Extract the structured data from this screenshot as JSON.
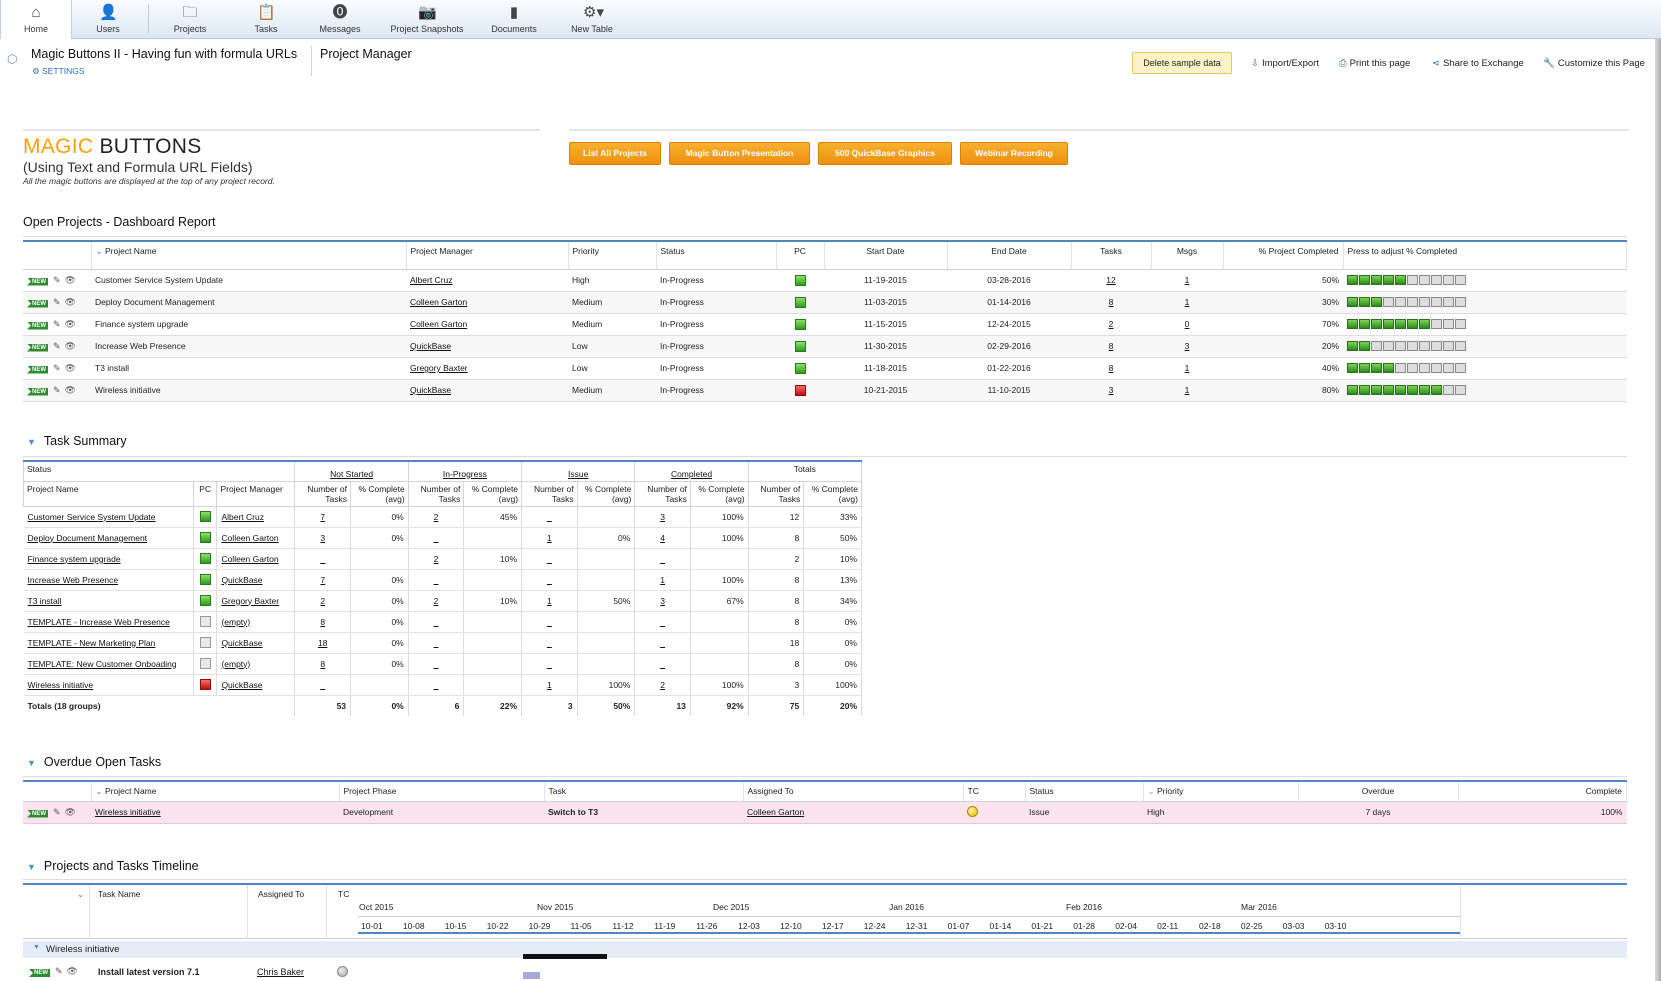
{
  "nav": [
    {
      "label": "Home",
      "icon": "home-icon",
      "glyph": "⌂",
      "active": true
    },
    {
      "label": "Users",
      "icon": "user-icon",
      "glyph": "👤"
    },
    {
      "label": "Projects",
      "icon": "folder-icon",
      "glyph": "🗀"
    },
    {
      "label": "Tasks",
      "icon": "clipboard-icon",
      "glyph": "📋"
    },
    {
      "label": "Messages",
      "icon": "speech-bubble-icon",
      "glyph": "⓿"
    },
    {
      "label": "Project Snapshots",
      "icon": "camera-icon",
      "glyph": "📷"
    },
    {
      "label": "Documents",
      "icon": "document-icon",
      "glyph": "▮"
    },
    {
      "label": "New Table",
      "icon": "gear-plus-icon",
      "glyph": "⚙▾"
    }
  ],
  "app": {
    "title": "Magic Buttons II - Having fun with formula URLs",
    "settings": "SETTINGS",
    "page": "Project Manager"
  },
  "toolbar": {
    "delete": "Delete sample data",
    "import": "Import/Export",
    "print": "Print this page",
    "share": "Share to Exchange",
    "customize": "Customize this Page"
  },
  "hero": {
    "title_accent": "MAGIC",
    "title_rest": " BUTTONS",
    "subtitle": "(Using Text and Formula URL Fields)",
    "note": "All the magic buttons are displayed at the top of any project record."
  },
  "buttons": [
    "List All Projects",
    "Magic Button Presentation",
    "500 QuickBase Graphics",
    "Webinar Recording"
  ],
  "open_projects": {
    "title": "Open Projects - Dashboard Report",
    "headers": [
      "Project Name",
      "Project Manager",
      "Priority",
      "Status",
      "PC",
      "Start Date",
      "End Date",
      "Tasks",
      "Msgs",
      "% Project Completed",
      "Press to adjust % Completed"
    ],
    "new_tag": "NEW",
    "rows": [
      {
        "name": "Customer Service System Update",
        "pm": "Albert Cruz",
        "priority": "High",
        "status": "In-Progress",
        "pc": "green",
        "start": "11-19-2015",
        "end": "03-28-2016",
        "tasks": "12",
        "msgs": "1",
        "pct": "50%",
        "bars": 5
      },
      {
        "name": "Deploy Document Management",
        "pm": "Colleen Garton",
        "priority": "Medium",
        "status": "In-Progress",
        "pc": "green",
        "start": "11-03-2015",
        "end": "01-14-2016",
        "tasks": "8",
        "msgs": "1",
        "pct": "30%",
        "bars": 3
      },
      {
        "name": "Finance system upgrade",
        "pm": "Colleen Garton",
        "priority": "Medium",
        "status": "In-Progress",
        "pc": "green",
        "start": "11-15-2015",
        "end": "12-24-2015",
        "tasks": "2",
        "msgs": "0",
        "pct": "70%",
        "bars": 7
      },
      {
        "name": "Increase Web Presence",
        "pm": "QuickBase",
        "priority": "Low",
        "status": "In-Progress",
        "pc": "green",
        "start": "11-30-2015",
        "end": "02-29-2016",
        "tasks": "8",
        "msgs": "3",
        "pct": "20%",
        "bars": 2
      },
      {
        "name": "T3 install",
        "pm": "Gregory Baxter",
        "priority": "Low",
        "status": "In-Progress",
        "pc": "green",
        "start": "11-18-2015",
        "end": "01-22-2016",
        "tasks": "8",
        "msgs": "1",
        "pct": "40%",
        "bars": 4
      },
      {
        "name": "Wireless initiative",
        "pm": "QuickBase",
        "priority": "Medium",
        "status": "In-Progress",
        "pc": "red",
        "start": "10-21-2015",
        "end": "11-10-2015",
        "tasks": "3",
        "msgs": "1",
        "pct": "80%",
        "bars": 8
      }
    ]
  },
  "task_summary": {
    "title": "Task Summary",
    "status_label": "Status",
    "groups": [
      "Not Started",
      "In-Progress",
      "Issue",
      "Completed",
      "Totals"
    ],
    "cols": [
      "Project Name",
      "PC",
      "Project Manager",
      "Number of Tasks",
      "% Complete (avg)"
    ],
    "rows": [
      {
        "name": "Customer Service System Update",
        "pc": "green",
        "pm": "Albert Cruz",
        "v": [
          "7",
          "0%",
          "2",
          "45%",
          "_",
          "",
          "3",
          "100%",
          "12",
          "33%"
        ]
      },
      {
        "name": "Deploy Document Management",
        "pc": "green",
        "pm": "Colleen Garton",
        "v": [
          "3",
          "0%",
          "_",
          "",
          "1",
          "0%",
          "4",
          "100%",
          "8",
          "50%"
        ]
      },
      {
        "name": "Finance system upgrade",
        "pc": "green",
        "pm": "Colleen Garton",
        "v": [
          "_",
          "",
          "2",
          "10%",
          "_",
          "",
          "_",
          "",
          "2",
          "10%"
        ]
      },
      {
        "name": "Increase Web Presence",
        "pc": "green",
        "pm": "QuickBase",
        "v": [
          "7",
          "0%",
          "_",
          "",
          "_",
          "",
          "1",
          "100%",
          "8",
          "13%"
        ]
      },
      {
        "name": "T3 install",
        "pc": "green",
        "pm": "Gregory Baxter",
        "v": [
          "2",
          "0%",
          "2",
          "10%",
          "1",
          "50%",
          "3",
          "67%",
          "8",
          "34%"
        ]
      },
      {
        "name": "TEMPLATE - Increase Web Presence",
        "pc": "white",
        "pm": "(empty)",
        "v": [
          "8",
          "0%",
          "_",
          "",
          "_",
          "",
          "_",
          "",
          "8",
          "0%"
        ]
      },
      {
        "name": "TEMPLATE - New Marketing Plan",
        "pc": "white",
        "pm": "QuickBase",
        "v": [
          "18",
          "0%",
          "_",
          "",
          "_",
          "",
          "_",
          "",
          "18",
          "0%"
        ]
      },
      {
        "name": "TEMPLATE: New Customer Onboading",
        "pc": "white",
        "pm": "(empty)",
        "v": [
          "8",
          "0%",
          "_",
          "",
          "_",
          "",
          "_",
          "",
          "8",
          "0%"
        ]
      },
      {
        "name": "Wireless initiative",
        "pc": "red",
        "pm": "QuickBase",
        "v": [
          "_",
          "",
          "_",
          "",
          "1",
          "100%",
          "2",
          "100%",
          "3",
          "100%"
        ]
      }
    ],
    "totals": {
      "label": "Totals (18 groups)",
      "v": [
        "53",
        "0%",
        "6",
        "22%",
        "3",
        "50%",
        "13",
        "92%",
        "75",
        "20%"
      ]
    }
  },
  "overdue": {
    "title": "Overdue Open Tasks",
    "headers": [
      "Project Name",
      "Project Phase",
      "Task",
      "Assigned To",
      "TC",
      "Status",
      "Priority",
      "Overdue",
      "Complete"
    ],
    "row": {
      "name": "Wireless initiative",
      "phase": "Development",
      "task": "Switch to T3",
      "assigned": "Colleen Garton",
      "status": "Issue",
      "priority": "High",
      "overdue": "7 days",
      "complete": "100%"
    }
  },
  "timeline": {
    "title": "Projects and Tasks Timeline",
    "headers": [
      "Task Name",
      "Assigned To",
      "TC"
    ],
    "months": [
      "Oct 2015",
      "Nov 2015",
      "Dec 2015",
      "Jan 2016",
      "Feb 2016",
      "Mar 2016"
    ],
    "weeks": [
      "10-01",
      "10-08",
      "10-15",
      "10-22",
      "10-29",
      "11-05",
      "11-12",
      "11-19",
      "11-26",
      "12-03",
      "12-10",
      "12-17",
      "12-24",
      "12-31",
      "01-07",
      "01-14",
      "01-21",
      "01-28",
      "02-04",
      "02-11",
      "02-18",
      "02-25",
      "03-03",
      "03-10"
    ],
    "group": "Wireless initiative",
    "task": {
      "name": "Install latest version 7.1",
      "assigned": "Chris Baker"
    }
  }
}
